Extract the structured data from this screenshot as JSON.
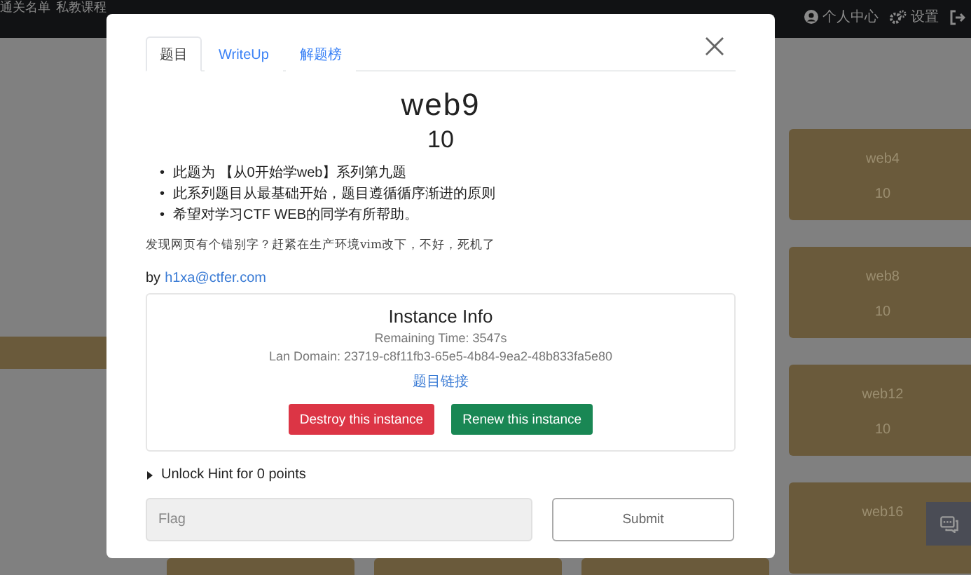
{
  "navbar": {
    "left_items": [
      "通关名单",
      "私教课程"
    ],
    "right_items": [
      {
        "kind": "user",
        "label": "个人中心"
      },
      {
        "kind": "settings",
        "label": "设置"
      },
      {
        "kind": "logout"
      }
    ]
  },
  "background_cards": [
    {
      "cards": [
        {
          "kind": "blank"
        }
      ]
    },
    {
      "cards": [
        {
          "kind": "blank"
        }
      ]
    },
    {
      "cards": [
        {
          "kind": "blank"
        }
      ]
    },
    {
      "cards": [
        {
          "kind": "blank"
        }
      ]
    },
    {
      "cards": [
        {
          "kind": "challenge",
          "name": "web4",
          "points": "10"
        },
        {
          "kind": "challenge",
          "name": "web8",
          "points": "10"
        },
        {
          "kind": "challenge",
          "name": "web12",
          "points": "10"
        },
        {
          "kind": "challenge",
          "name": "web16"
        }
      ]
    }
  ],
  "modal": {
    "tabs": [
      {
        "label": "题目",
        "selected": true
      },
      {
        "label": "WriteUp",
        "selected": false
      },
      {
        "label": "解题榜",
        "selected": false
      }
    ],
    "title": "web9",
    "points": "10",
    "bullet_marker": "•",
    "bullets": [
      "此题为 【从0开始学web】系列第九题",
      "此系列题目从最基础开始，题目遵循循序渐进的原则",
      "希望对学习CTF WEB的同学有所帮助。"
    ],
    "note": "发现网页有个错别字？赶紧在生产环境vim改下，不好，死机了",
    "author_prefix": "by",
    "author": "h1xa@ctfer.com",
    "instance": {
      "title": "Instance Info",
      "remaining": "Remaining Time: 3547s",
      "domain": "Lan Domain: 23719-c8f11fb3-65e5-4b84-9ea2-48b833fa5e80",
      "link": "题目链接",
      "buttons": [
        {
          "kind": "danger",
          "label": "Destroy this instance"
        },
        {
          "kind": "success",
          "label": "Renew this instance"
        }
      ]
    },
    "hint": {
      "label": "Unlock Hint for 0 points",
      "expanded": false
    },
    "flag": {
      "placeholder": "Flag"
    },
    "submit": "Submit"
  }
}
